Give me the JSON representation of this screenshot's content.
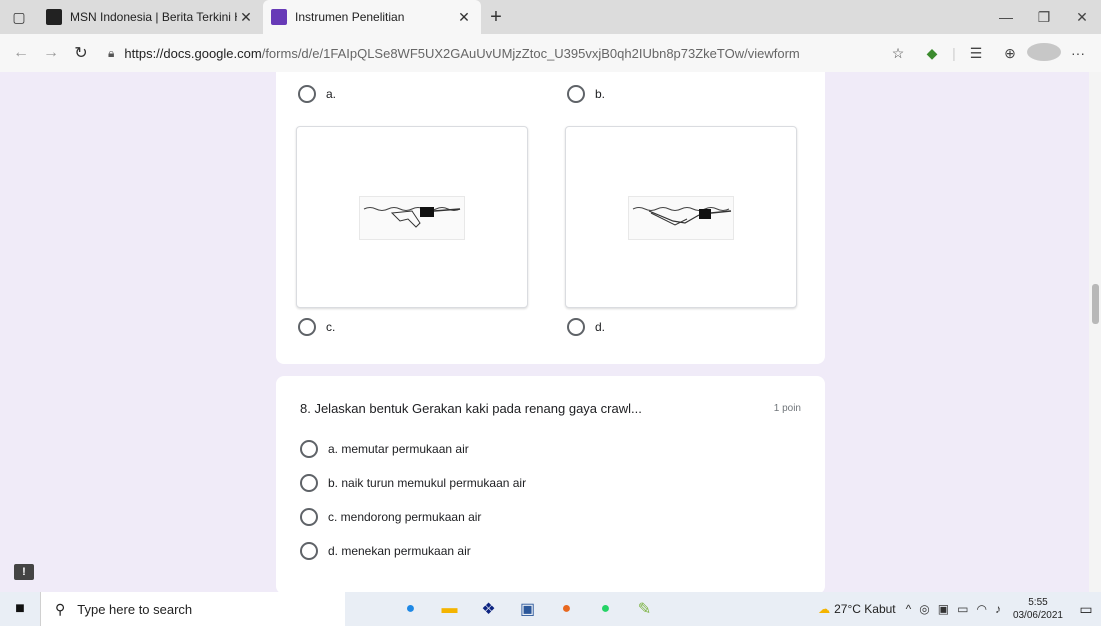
{
  "tabs": [
    {
      "title": "MSN Indonesia | Berita Terkini H",
      "active": false
    },
    {
      "title": "Instrumen Penelitian",
      "active": true
    }
  ],
  "address": {
    "host": "https://docs.google.com",
    "path": "/forms/d/e/1FAIpQLSe8WF5UX2GAuUvUMjzZtoc_U395vxjB0qh2IUbn8p73ZkeTOw/viewform"
  },
  "question7": {
    "options": [
      "a.",
      "b.",
      "c.",
      "d."
    ]
  },
  "question8": {
    "title": "8. Jelaskan bentuk Gerakan kaki pada renang gaya crawl...",
    "points": "1 poin",
    "options": [
      "a. memutar permukaan air",
      "b. naik turun memukul permukaan air",
      "c. mendorong permukaan air",
      "d. menekan permukaan air"
    ]
  },
  "taskbar": {
    "search_placeholder": "Type here to search",
    "weather": "27°C Kabut",
    "time": "5:55",
    "date": "03/06/2021"
  },
  "colors": {
    "page_bg": "#f0ebf8",
    "forms_purple": "#673ab7"
  },
  "icons": {
    "forms_tab": "forms-icon",
    "msn_tab": "msn-icon"
  }
}
